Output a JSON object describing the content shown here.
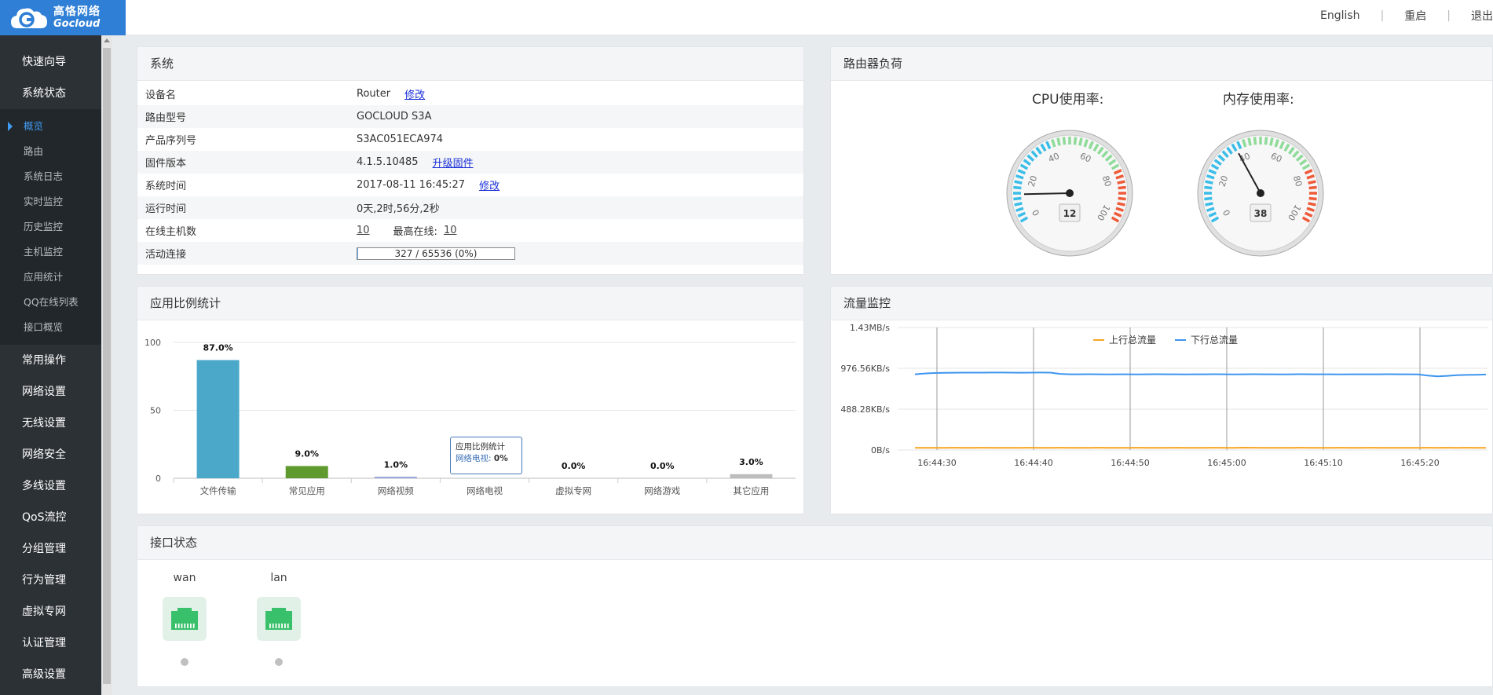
{
  "brand": {
    "name_cn": "高恪网络",
    "name_en": "Gocloud"
  },
  "topbar": {
    "language_link": "English",
    "restart_link": "重启",
    "logout_link": "退出"
  },
  "sidebar": {
    "groups_top": [
      {
        "label": "快速向导"
      },
      {
        "label": "系统状态"
      }
    ],
    "sub_items": [
      {
        "label": "概览",
        "active": true
      },
      {
        "label": "路由"
      },
      {
        "label": "系统日志"
      },
      {
        "label": "实时监控"
      },
      {
        "label": "历史监控"
      },
      {
        "label": "主机监控"
      },
      {
        "label": "应用统计"
      },
      {
        "label": "QQ在线列表"
      },
      {
        "label": "接口概览"
      }
    ],
    "groups_bottom": [
      {
        "label": "常用操作"
      },
      {
        "label": "网络设置"
      },
      {
        "label": "无线设置"
      },
      {
        "label": "网络安全"
      },
      {
        "label": "多线设置"
      },
      {
        "label": "QoS流控"
      },
      {
        "label": "分组管理"
      },
      {
        "label": "行为管理"
      },
      {
        "label": "虚拟专网"
      },
      {
        "label": "认证管理"
      },
      {
        "label": "高级设置"
      }
    ]
  },
  "system_panel": {
    "title": "系统",
    "device_name": {
      "label": "设备名",
      "value": "Router",
      "action": "修改"
    },
    "model": {
      "label": "路由型号",
      "value": "GOCLOUD S3A"
    },
    "serial": {
      "label": "产品序列号",
      "value": "S3AC051ECA974"
    },
    "firmware": {
      "label": "固件版本",
      "value": "4.1.5.10485",
      "action": "升级固件"
    },
    "time": {
      "label": "系统时间",
      "value": "2017-08-11 16:45:27",
      "action": "修改"
    },
    "uptime": {
      "label": "运行时间",
      "value": "0天,2时,56分,2秒"
    },
    "hosts": {
      "label": "在线主机数",
      "value": "10",
      "max_label": "最高在线:",
      "max_value": "10"
    },
    "connections": {
      "label": "活动连接",
      "value": "327 / 65536 (0%)",
      "fraction": 0.005
    }
  },
  "load_panel": {
    "title": "路由器负荷",
    "cpu": {
      "label": "CPU使用率:",
      "value": 12,
      "value_text": "12"
    },
    "mem": {
      "label": "内存使用率:",
      "value": 38,
      "value_text": "38"
    },
    "gauge_ticks": [
      "0",
      "20",
      "40",
      "60",
      "80",
      "100"
    ],
    "colors": {
      "low": "#3cbde8",
      "mid": "#8fdb9a",
      "high": "#ee5b3b"
    }
  },
  "app_panel": {
    "title": "应用比例统计"
  },
  "traffic_panel": {
    "title": "流量监控"
  },
  "iface_panel": {
    "title": "接口状态",
    "ports": [
      {
        "name": "wan"
      },
      {
        "name": "lan"
      }
    ],
    "icon_color": "#39c06a"
  },
  "chart_data": [
    {
      "type": "bar",
      "categories": [
        "文件传输",
        "常见应用",
        "网络视频",
        "网络电视",
        "虚拟专网",
        "网络游戏",
        "其它应用"
      ],
      "values": [
        87.0,
        9.0,
        1.0,
        0.0,
        0.0,
        0.0,
        3.0
      ],
      "value_labels": [
        "87.0%",
        "9.0%",
        "1.0%",
        "0.0%",
        "0.0%",
        "0.0%",
        "3.0%"
      ],
      "colors": [
        "#4ba8c9",
        "#5e9a2e",
        "#9aa6d8",
        "#cccccc",
        "#cccccc",
        "#cccccc",
        "#bdbdbd"
      ],
      "ylim": [
        0,
        100
      ],
      "yticks": [
        "0",
        "50",
        "100"
      ],
      "tooltip": {
        "title": "应用比例统计",
        "series": "网络电视:",
        "value": "0%"
      }
    },
    {
      "type": "line",
      "x": [
        "16:44:30",
        "16:44:40",
        "16:44:50",
        "16:45:00",
        "16:45:10",
        "16:45:20"
      ],
      "yticks": [
        "0B/s",
        "488.28KB/s",
        "976.56KB/s",
        "1.43MB/s"
      ],
      "ylim_kb": [
        0,
        1464.84
      ],
      "series": [
        {
          "name": "上行总流量",
          "color": "#f5a623",
          "values": [
            25,
            26,
            26,
            26,
            27,
            26,
            26,
            27,
            26,
            26,
            25,
            26,
            27,
            26,
            26,
            27,
            26,
            26,
            26,
            27,
            26,
            26,
            26,
            27,
            26,
            25,
            26,
            27,
            26,
            26,
            26,
            27,
            26,
            26,
            28,
            27,
            26,
            25,
            26,
            26,
            27,
            26,
            26,
            26,
            27,
            26,
            26,
            27,
            26,
            26,
            25,
            26,
            26,
            27,
            26,
            27,
            26,
            27,
            26,
            25
          ]
        },
        {
          "name": "下行总流量",
          "color": "#3d95ef",
          "values": [
            905,
            915,
            920,
            922,
            924,
            925,
            925,
            925,
            926,
            926,
            925,
            924,
            925,
            926,
            925,
            910,
            905,
            905,
            906,
            905,
            904,
            905,
            905,
            904,
            905,
            906,
            905,
            905,
            904,
            905,
            905,
            906,
            905,
            904,
            905,
            906,
            905,
            905,
            904,
            905,
            906,
            905,
            905,
            905,
            904,
            905,
            905,
            905,
            905,
            906,
            905,
            905,
            904,
            890,
            880,
            886,
            895,
            898,
            900,
            902
          ]
        }
      ]
    }
  ]
}
